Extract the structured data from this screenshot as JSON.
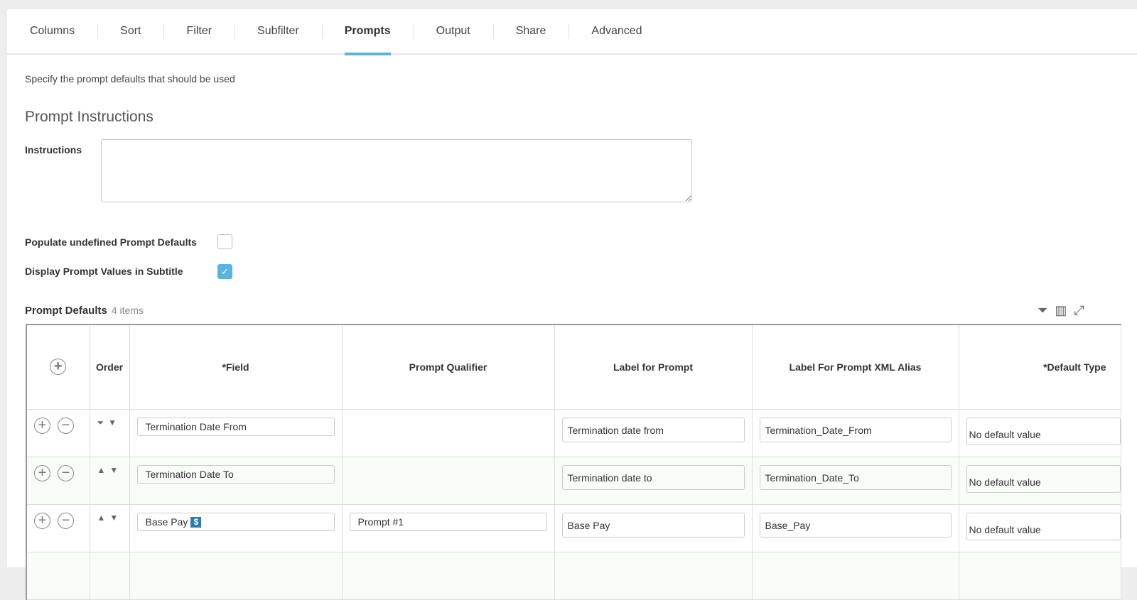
{
  "tabs": [
    "Columns",
    "Sort",
    "Filter",
    "Subfilter",
    "Prompts",
    "Output",
    "Share",
    "Advanced"
  ],
  "active_tab": "Prompts",
  "description": "Specify the prompt defaults that should be used",
  "section_title": "Prompt Instructions",
  "instructions_label": "Instructions",
  "instructions_value": "",
  "populate_label": "Populate undefined Prompt Defaults",
  "populate_checked": false,
  "display_label": "Display Prompt Values in Subtitle",
  "display_checked": true,
  "grid": {
    "title": "Prompt Defaults",
    "count": "4 items",
    "icons": [
      "filter-icon",
      "columns-icon",
      "expand-icon"
    ],
    "headers": [
      "Order",
      "*Field",
      "Prompt Qualifier",
      "Label for Prompt",
      "Label For Prompt XML Alias",
      "*Default Type"
    ],
    "rows": [
      {
        "field": "Termination Date From",
        "qualifier": "",
        "label": "Termination date from",
        "alias": "Termination_Date_From",
        "default_type": "No default value"
      },
      {
        "field": "Termination Date To",
        "qualifier": "",
        "label": "Termination date to",
        "alias": "Termination_Date_To",
        "default_type": "No default value"
      },
      {
        "field": "Base Pay",
        "currency_icon": true,
        "qualifier": "Prompt #1",
        "label": "Base Pay",
        "alias": "Base_Pay",
        "default_type": "No default value"
      }
    ]
  },
  "colors": {
    "accent": "#5ab4e0",
    "currency_icon": "#2d7ab8"
  }
}
